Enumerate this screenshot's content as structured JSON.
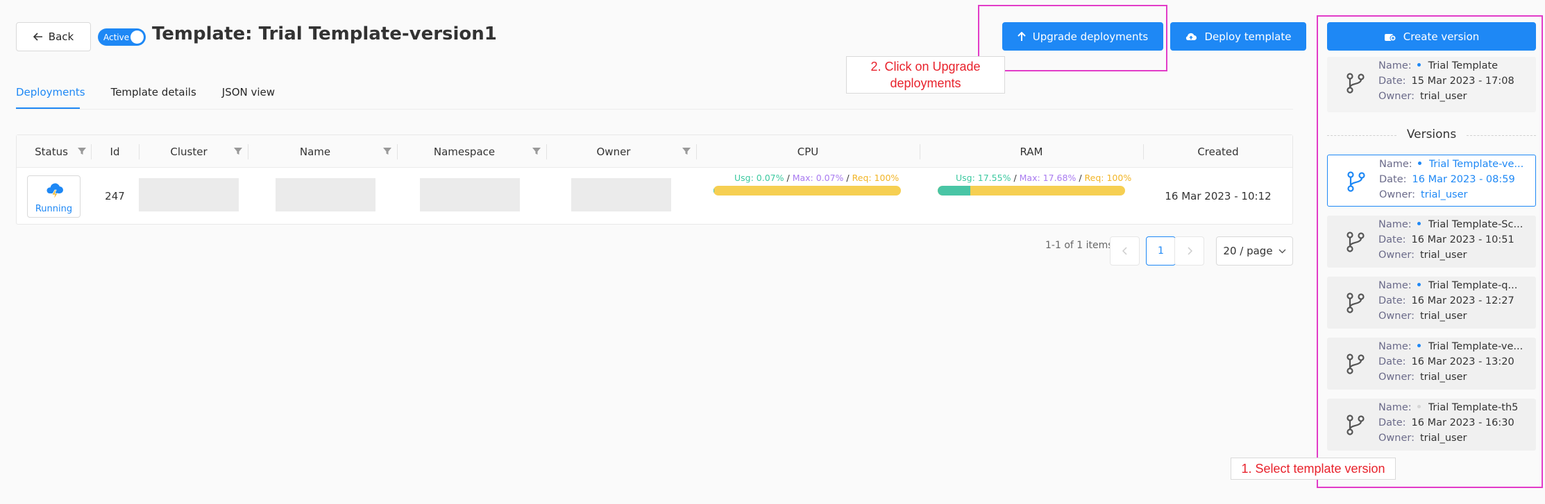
{
  "header": {
    "back_label": "Back",
    "active_label": "Active",
    "title": "Template: Trial Template-version1",
    "upgrade_label": "Upgrade deployments",
    "deploy_label": "Deploy template",
    "create_version_label": "Create version"
  },
  "tabs": [
    {
      "label": "Deployments",
      "active": true
    },
    {
      "label": "Template details",
      "active": false
    },
    {
      "label": "JSON view",
      "active": false
    }
  ],
  "table": {
    "columns": [
      "Status",
      "Id",
      "Cluster",
      "Name",
      "Namespace",
      "Owner",
      "CPU",
      "RAM",
      "Created"
    ],
    "rows": [
      {
        "status": "Running",
        "id": "247",
        "cpu": {
          "usg": "Usg: 0.07%",
          "max": "Max: 0.07%",
          "req": "Req: 100%",
          "fill_fraction": 0.0007
        },
        "ram": {
          "usg": "Usg: 17.55%",
          "max": "Max: 17.68%",
          "req": "Req: 100%",
          "fill_fraction": 0.1755
        },
        "created": "16 Mar 2023 - 10:12"
      }
    ]
  },
  "pagination": {
    "summary": "1-1 of 1 items",
    "current_page": "1",
    "page_size": "20 / page"
  },
  "versions": {
    "title": "Versions",
    "labels": {
      "name": "Name:",
      "date": "Date:",
      "owner": "Owner:"
    },
    "current": {
      "name": "Trial Template",
      "date": "15 Mar 2023 - 17:08",
      "owner": "trial_user"
    },
    "items": [
      {
        "name": "Trial Template-ve...",
        "date": "16 Mar 2023 - 08:59",
        "owner": "trial_user",
        "selected": true,
        "dot": "blue"
      },
      {
        "name": "Trial Template-Sc...",
        "date": "16 Mar 2023 - 10:51",
        "owner": "trial_user",
        "selected": false,
        "dot": "blue"
      },
      {
        "name": "Trial Template-q...",
        "date": "16 Mar 2023 - 12:27",
        "owner": "trial_user",
        "selected": false,
        "dot": "blue"
      },
      {
        "name": "Trial Template-ve...",
        "date": "16 Mar 2023 - 13:20",
        "owner": "trial_user",
        "selected": false,
        "dot": "blue"
      },
      {
        "name": "Trial Template-th5",
        "date": "16 Mar 2023 - 16:30",
        "owner": "trial_user",
        "selected": false,
        "dot": "grey"
      }
    ]
  },
  "annotations": {
    "step1": "1. Select template version",
    "step2_line1": "2. Click on Upgrade",
    "step2_line2": "deployments"
  },
  "colors": {
    "primary": "#1e88f5",
    "annotation_border": "#e23cc8",
    "annotation_text": "#e8222c",
    "usage": "#3cc9a0",
    "max": "#a97bf0",
    "request": "#f2b526"
  },
  "icons": [
    "arrow-left-icon",
    "upload-arrow-icon",
    "cloud-upload-icon",
    "create-version-icon",
    "filter-icon",
    "cloud-lightning-icon",
    "git-branch-icon",
    "chevron-down-icon",
    "chevron-left-icon",
    "chevron-right-icon"
  ]
}
